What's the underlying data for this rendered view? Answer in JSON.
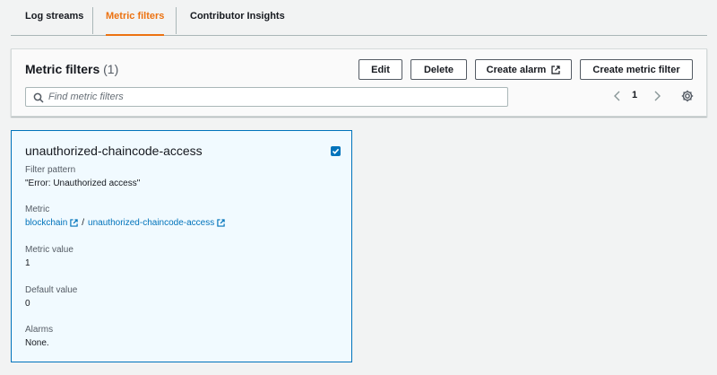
{
  "tabs": [
    {
      "label": "Log streams",
      "active": false
    },
    {
      "label": "Metric filters",
      "active": true
    },
    {
      "label": "Contributor Insights",
      "active": false
    }
  ],
  "panel": {
    "title": "Metric filters",
    "count": "(1)",
    "buttons": {
      "edit": "Edit",
      "delete": "Delete",
      "create_alarm": "Create alarm",
      "create_metric_filter": "Create metric filter"
    },
    "search": {
      "placeholder": "Find metric filters",
      "value": ""
    },
    "pagination": {
      "current_page": "1"
    }
  },
  "card": {
    "title": "unauthorized-chaincode-access",
    "selected": true,
    "filter_pattern": {
      "label": "Filter pattern",
      "value": "\"Error: Unauthorized access\""
    },
    "metric": {
      "label": "Metric",
      "namespace": "blockchain",
      "separator": "/",
      "name": "unauthorized-chaincode-access"
    },
    "metric_value": {
      "label": "Metric value",
      "value": "1"
    },
    "default_value": {
      "label": "Default value",
      "value": "0"
    },
    "alarms": {
      "label": "Alarms",
      "value": "None."
    }
  },
  "colors": {
    "accent": "#ec7211",
    "link": "#0073bb",
    "selected_bg": "#f1faff",
    "page_bg": "#f2f3f3"
  },
  "icons": [
    "external-link-icon",
    "search-icon",
    "chevron-left-icon",
    "chevron-right-icon",
    "gear-icon",
    "checkmark-icon"
  ]
}
